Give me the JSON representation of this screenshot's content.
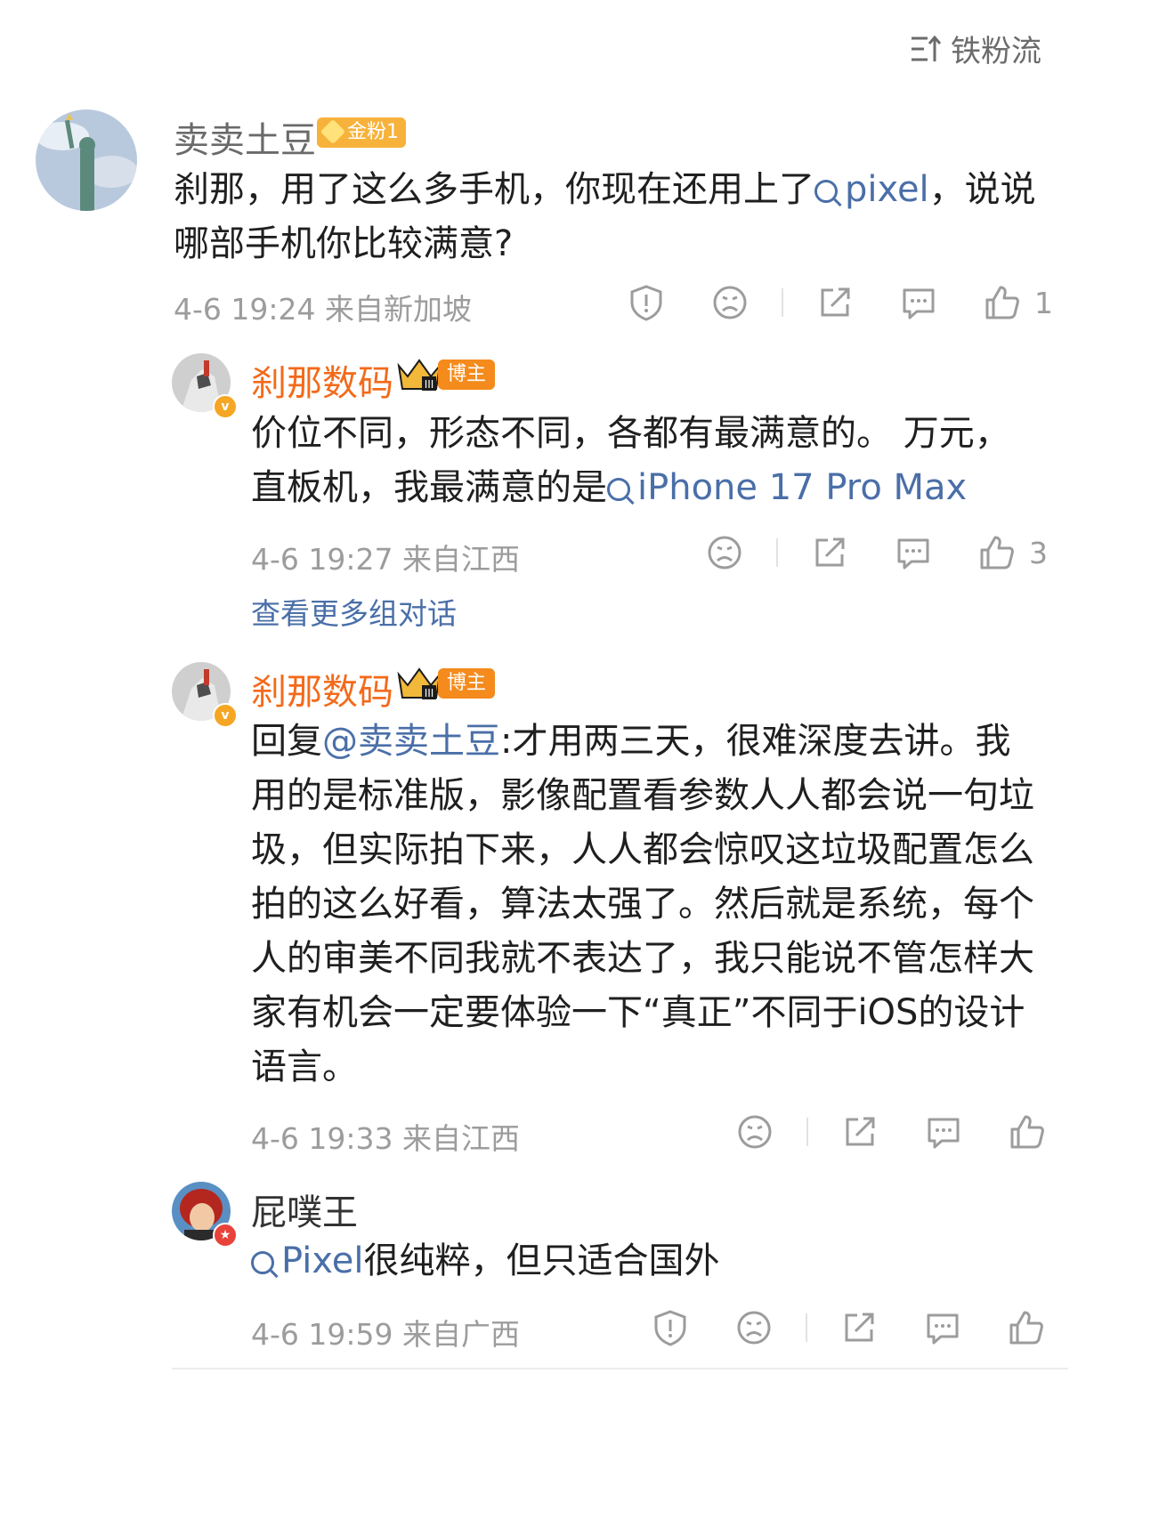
{
  "header": {
    "sort_label": "铁粉流"
  },
  "comments": [
    {
      "user": "卖卖土豆",
      "fan_badge": "金粉1",
      "text_before": "刹那，用了这么多手机，你现在还用上了",
      "topic": "pixel",
      "text_after": "，说说哪部手机你比较满意?",
      "meta": "4-6 19:24  来自新加坡",
      "likes": "1"
    },
    {
      "user": "刹那数码",
      "role_badge": "博主",
      "text_before": "价位不同，形态不同，各都有最满意的。 万元，直板机，我最满意的是",
      "topic": "iPhone 17 Pro Max",
      "meta": "4-6 19:27  来自江西",
      "likes": "3",
      "more_link": "查看更多组对话"
    },
    {
      "user": "刹那数码",
      "role_badge": "博主",
      "reply_prefix": "回复",
      "mention": "@卖卖土豆",
      "text_after": ":才用两三天，很难深度去讲。我用的是标准版，影像配置看参数人人都会说一句垃圾，但实际拍下来，人人都会惊叹这垃圾配置怎么拍的这么好看，算法太强了。然后就是系统，每个人的审美不同我就不表达了，我只能说不管怎样大家有机会一定要体验一下“真正”不同于iOS的设计语言。",
      "meta": "4-6 19:33  来自江西"
    },
    {
      "user": "屁噗王",
      "topic": "Pixel",
      "text_after": "很纯粹，但只适合国外",
      "meta": "4-6 19:59  来自广西"
    }
  ],
  "colors": {
    "link": "#4a6fa8",
    "blogger_name": "#f36a1a",
    "meta": "#9c9c9c"
  }
}
